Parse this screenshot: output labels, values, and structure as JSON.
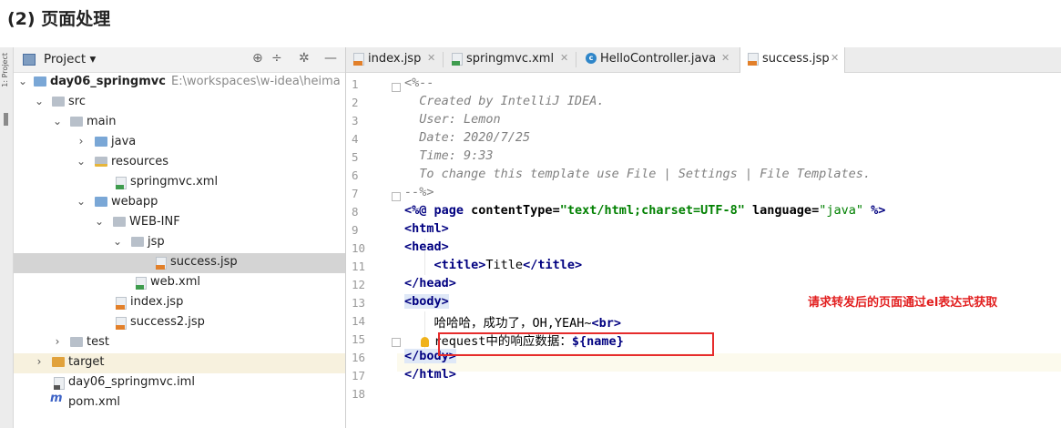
{
  "heading": "(2) 页面处理",
  "sidebar_strip_label": "1: Project",
  "project_panel": {
    "title": "Project ▾",
    "toolbar_icons": [
      "crosshair-icon",
      "collapse-icon",
      "gear-icon",
      "minimize-icon"
    ],
    "tree": [
      {
        "label": "day06_springmvc",
        "path": "E:\\workspaces\\w-idea\\heima",
        "icon": "module-folder-icon",
        "expanded": true
      },
      {
        "label": "src",
        "icon": "folder-icon",
        "expanded": true
      },
      {
        "label": "main",
        "icon": "folder-icon",
        "expanded": true
      },
      {
        "label": "java",
        "icon": "source-folder-icon",
        "expanded": false
      },
      {
        "label": "resources",
        "icon": "resources-folder-icon",
        "expanded": true
      },
      {
        "label": "springmvc.xml",
        "icon": "xml-file-icon"
      },
      {
        "label": "webapp",
        "icon": "web-folder-icon",
        "expanded": true
      },
      {
        "label": "WEB-INF",
        "icon": "folder-icon",
        "expanded": true
      },
      {
        "label": "jsp",
        "icon": "folder-icon",
        "expanded": true
      },
      {
        "label": "success.jsp",
        "icon": "jsp-file-icon",
        "selected": true
      },
      {
        "label": "web.xml",
        "icon": "xml-file-icon"
      },
      {
        "label": "index.jsp",
        "icon": "jsp-file-icon"
      },
      {
        "label": "success2.jsp",
        "icon": "jsp-file-icon"
      },
      {
        "label": "test",
        "icon": "folder-icon",
        "expanded": false
      },
      {
        "label": "target",
        "icon": "target-folder-icon",
        "expanded": false,
        "highlighted": true
      },
      {
        "label": "day06_springmvc.iml",
        "icon": "iml-file-icon"
      },
      {
        "label": "pom.xml",
        "icon": "maven-icon"
      }
    ]
  },
  "editor": {
    "tabs": [
      {
        "label": "index.jsp",
        "icon": "jsp-file-icon",
        "active": false
      },
      {
        "label": "springmvc.xml",
        "icon": "xml-file-icon",
        "active": false
      },
      {
        "label": "HelloController.java",
        "icon": "class-icon",
        "active": false
      },
      {
        "label": "success.jsp",
        "icon": "jsp-file-icon",
        "active": true
      }
    ],
    "line_numbers": [
      "1",
      "2",
      "3",
      "4",
      "5",
      "6",
      "7",
      "8",
      "9",
      "10",
      "11",
      "12",
      "13",
      "14",
      "15",
      "16",
      "17",
      "18"
    ],
    "code": {
      "l1": "<%--",
      "l2": "  Created by IntelliJ IDEA.",
      "l3": "  User: Lemon",
      "l4": "  Date: 2020/7/25",
      "l5": "  Time: 9:33",
      "l6": "  To change this template use File | Settings | File Templates.",
      "l7": "--%>",
      "l8_open": "<%@ ",
      "l8_page": "page ",
      "l8_ct": "contentType",
      "l8_eq1": "=",
      "l8_ctv": "\"text/html;charset=UTF-8\"",
      "l8_lang": " language",
      "l8_eq2": "=",
      "l8_langv": "\"java\"",
      "l8_close": " %>",
      "l9": "<html>",
      "l10": "<head>",
      "l11_indent": "    ",
      "l11_open": "<title>",
      "l11_text": "Title",
      "l11_close": "</title>",
      "l12": "</head>",
      "l13": "<body>",
      "l14_indent": "    ",
      "l14_text": "哈哈哈，成功了，OH,YEAH~",
      "l14_tag": "<br>",
      "l15_indent": "    ",
      "l15_text": "request中的响应数据：",
      "l15_el": "${name}",
      "l16": "</body>",
      "l17": "</html>",
      "l18": ""
    },
    "annotation": "请求转发后的页面通过el表达式获取"
  }
}
